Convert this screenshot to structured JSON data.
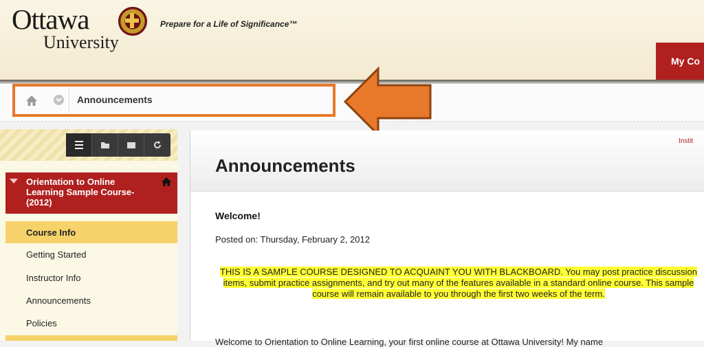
{
  "header": {
    "logo_word": "Ottawa",
    "logo_sub": "University",
    "tagline": "Prepare for a Life of Significance™",
    "tab_label": "My Co"
  },
  "breadcrumb": {
    "current": "Announcements"
  },
  "sidebar": {
    "course_title": "Orientation to Online Learning Sample Course-(2012)",
    "items": [
      {
        "label": "Course Info",
        "active": true
      },
      {
        "label": "Getting Started"
      },
      {
        "label": "Instructor Info"
      },
      {
        "label": "Announcements"
      },
      {
        "label": "Policies"
      }
    ]
  },
  "main": {
    "institution_link": "Instit",
    "title": "Announcements",
    "announcement": {
      "heading": "Welcome!",
      "posted": "Posted on: Thursday, February 2, 2012",
      "notice": "THIS IS A SAMPLE COURSE DESIGNED TO ACQUAINT YOU WITH BLACKBOARD. You may post practice discussion items, submit practice assignments, and try out many of the features available in a standard online course. This sample course will remain available to you through the first two weeks of the term.",
      "intro": "Welcome to Orientation to Online Learning, your first online course at Ottawa University! My name"
    }
  },
  "colors": {
    "brand_red": "#b0201f",
    "highlight_orange": "#e8782a",
    "active_item": "#f5d36a",
    "notice_highlight": "#ffff33"
  }
}
